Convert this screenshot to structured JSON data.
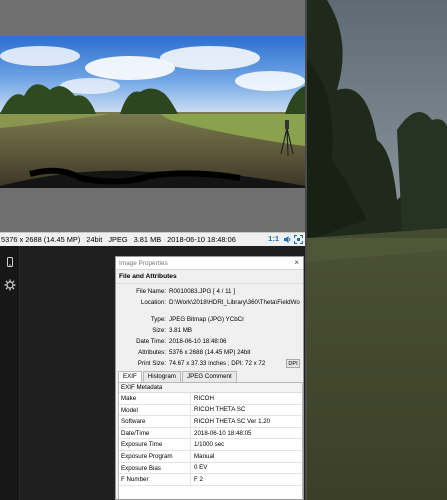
{
  "status_bar": {
    "dimensions": "5376 x 2688 (14.45 MP)",
    "bitdepth": "24bit",
    "format": "JPEG",
    "filesize": "3.81 MB",
    "datetime": "2018-06-10 18:48:06",
    "zoom_ratio": "1:1"
  },
  "dialog": {
    "title": "Image Properties",
    "close_label": "×",
    "section_title": "File and Attributes",
    "properties": [
      {
        "key": "File Name:",
        "value": "R0010083.JPG  [ 4 / 11 ]"
      },
      {
        "key": "Location:",
        "value": "D:\\Work\\2018\\HDRI_Library\\360\\Theta\\FieldWo"
      },
      {
        "key": "Type:",
        "value": "JPEG Bitmap (JPG) YCbCr"
      },
      {
        "key": "Size:",
        "value": "3.81 MB"
      },
      {
        "key": "Date Time:",
        "value": "2018-06-10 18:48:06"
      },
      {
        "key": "Attributes:",
        "value": "5376 x 2688 (14.45 MP)  24bit"
      },
      {
        "key": "Print Size:",
        "value": "74.67 x 37.33 inches ;   DPI: 72 x 72"
      }
    ],
    "dpi_button": "DPI",
    "tabs": [
      "EXIF",
      "Histogram",
      "JPEG Comment"
    ],
    "exif_header": "EXIF Metadata",
    "exif_rows": [
      {
        "key": "Make",
        "value": "RICOH"
      },
      {
        "key": "Model",
        "value": "RICOH THETA SC"
      },
      {
        "key": "Software",
        "value": "RICOH THETA SC Ver 1.20"
      },
      {
        "key": "Date/Time",
        "value": "2018-06-10 18:48:05"
      },
      {
        "key": "Exposure Time",
        "value": "1/1000 sec"
      },
      {
        "key": "Exposure Program",
        "value": "Manual"
      },
      {
        "key": "Exposure Bias",
        "value": "0 EV"
      },
      {
        "key": "F Number",
        "value": "F 2"
      }
    ]
  },
  "icons": {
    "sidebar": [
      "phone-icon",
      "gear-icon"
    ],
    "statusbar": [
      "speaker-icon",
      "fit-screen-icon"
    ]
  }
}
